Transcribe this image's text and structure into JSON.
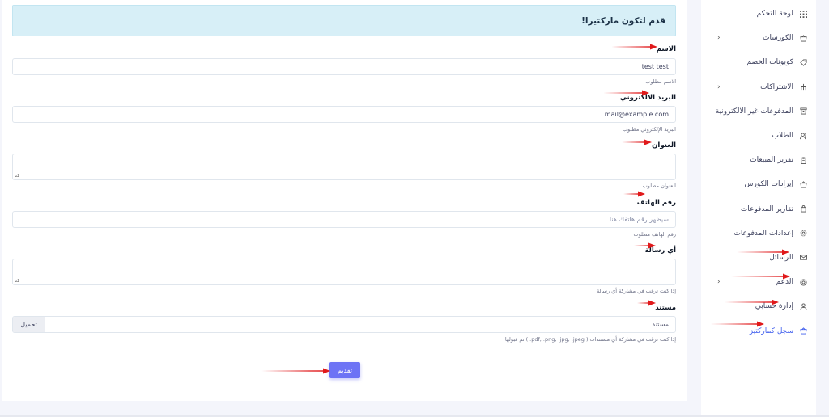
{
  "sidebar": {
    "items": [
      {
        "label": "لوحة التحكم",
        "icon": "grid-icon",
        "chevron": false
      },
      {
        "label": "الكورسات",
        "icon": "basket-icon",
        "chevron": true
      },
      {
        "label": "كوبونات الخصم",
        "icon": "tag-icon",
        "chevron": false
      },
      {
        "label": "الاشتراكات",
        "icon": "hierarchy-icon",
        "chevron": true
      },
      {
        "label": "المدفوعات غير الالكترونية",
        "icon": "archive-icon",
        "chevron": false
      },
      {
        "label": "الطلاب",
        "icon": "users-icon",
        "chevron": false
      },
      {
        "label": "تقرير المبيعات",
        "icon": "clipboard-icon",
        "chevron": false
      },
      {
        "label": "إيرادات الكورس",
        "icon": "basket-icon",
        "chevron": false
      },
      {
        "label": "تقارير المدفوعات",
        "icon": "bag-icon",
        "chevron": false
      },
      {
        "label": "إعدادات المدفوعات",
        "icon": "gear-icon",
        "chevron": false
      },
      {
        "label": "الرسائل",
        "icon": "mail-icon",
        "chevron": false
      },
      {
        "label": "الدعم",
        "icon": "lifebuoy-icon",
        "chevron": true
      },
      {
        "label": "إدارة حسابي",
        "icon": "user-icon",
        "chevron": false
      },
      {
        "label": "سجل كماركتيز",
        "icon": "basket-icon",
        "chevron": false,
        "active": true
      }
    ],
    "chevron_glyph": "‹"
  },
  "form": {
    "title": "قدم لتكون ماركتيرا!",
    "name": {
      "label": "الاسم",
      "value": "test test",
      "help": "الاسم مطلوب"
    },
    "email": {
      "label": "البريد الالكتروني",
      "value": "mail@example.com",
      "help": "البريد الإلكتروني مطلوب"
    },
    "address": {
      "label": "العنوان",
      "value": "",
      "help": "العنوان مطلوب"
    },
    "phone": {
      "label": "رقم الهاتف",
      "placeholder": "سيظهر رقم هاتفك هنا",
      "help": "رقم الهاتف مطلوب"
    },
    "message": {
      "label": "أي رسالة",
      "value": "",
      "help": "إذا كنت ترغب في مشاركة أي رسالة"
    },
    "document": {
      "label": "مستند",
      "file_text": "مستند",
      "button": "تحميل",
      "help": "إذا كنت ترغب في مشاركة أي مستندات ( pdf, .png, .jpg, .jpeg. ) تم قبولها"
    },
    "submit": "تقديم",
    "resize_glyph": "⊿"
  },
  "colors": {
    "accent": "#4361ee",
    "button": "#6d73f5",
    "alert_bg": "#d7eff7",
    "arrow": "#e0191b"
  }
}
